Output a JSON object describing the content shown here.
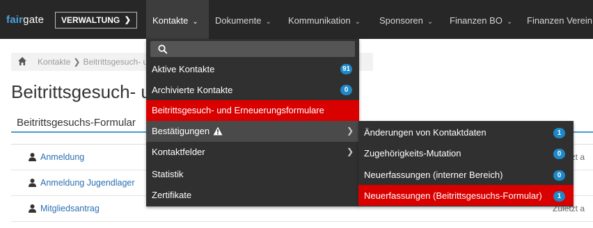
{
  "app": {
    "logo_brand": "fair",
    "logo_rest": "gate",
    "mode": "VERWALTUNG"
  },
  "nav": [
    {
      "label": "Kontakte"
    },
    {
      "label": "Dokumente"
    },
    {
      "label": "Kommunikation"
    },
    {
      "label": "Sponsoren"
    },
    {
      "label": "Finanzen BO"
    },
    {
      "label": "Finanzen Verein"
    }
  ],
  "breadcrumb": {
    "item1": "Kontakte",
    "item2": "Beitrittsgesuch- u"
  },
  "page_title": "Beitrittsgesuch- u",
  "section_title": "Beitrittsgesuchs-Formular",
  "forms": [
    {
      "label": "Anmeldung",
      "meta": "Zuletzt a"
    },
    {
      "label": "Anmeldung Jugendlager",
      "meta": ""
    },
    {
      "label": "Mitgliedsantrag",
      "meta": "Zuletzt a"
    }
  ],
  "dropdown": {
    "items": [
      {
        "label": "Aktive Kontakte",
        "badge": "91"
      },
      {
        "label": "Archivierte Kontakte",
        "badge": "0"
      },
      {
        "label": "Beitrittsgesuch- und Erneuerungsformulare"
      },
      {
        "label": "Bestätigungen"
      },
      {
        "label": "Kontaktfelder"
      },
      {
        "label": "Statistik"
      },
      {
        "label": "Zertifikate"
      }
    ]
  },
  "submenu": {
    "items": [
      {
        "label": "Änderungen von Kontaktdaten",
        "badge": "1"
      },
      {
        "label": "Zugehörigkeits-Mutation",
        "badge": "0"
      },
      {
        "label": "Neuerfassungen (interner Bereich)",
        "badge": "0"
      },
      {
        "label": "Neuerfassungen (Beitrittsgesuchs-Formular)",
        "badge": "1"
      }
    ]
  },
  "colors": {
    "topbar": "#272727",
    "accent_red": "#d90000",
    "badge_blue": "#1e88c8",
    "link_blue": "#2a6fb3"
  }
}
